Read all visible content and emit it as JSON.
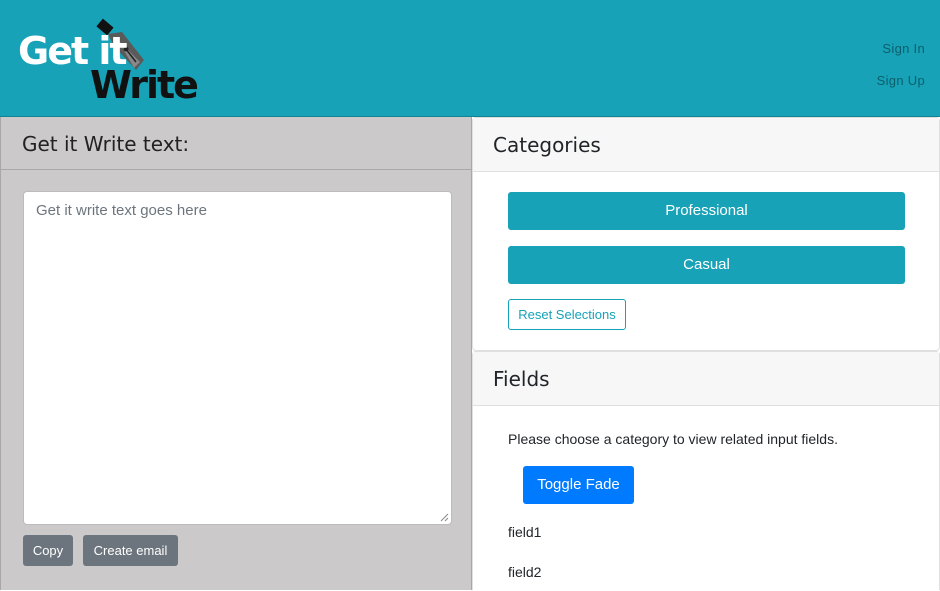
{
  "header": {
    "logo": {
      "line1": "Get it",
      "line2": "Write",
      "icon": "fountain-pen-icon"
    },
    "nav": {
      "sign_in": "Sign In",
      "sign_up": "Sign Up"
    },
    "colors": {
      "bar": "#17a2b8"
    }
  },
  "left": {
    "title": "Get it Write text:",
    "editor_placeholder": "Get it write text goes here",
    "copy_label": "Copy",
    "email_label": "Create email"
  },
  "categories": {
    "title": "Categories",
    "options": [
      "Professional",
      "Casual"
    ],
    "reset_label": "Reset Selections"
  },
  "fields": {
    "title": "Fields",
    "prompt": "Please choose a category to view related input fields.",
    "toggle_label": "Toggle Fade",
    "items": [
      "field1",
      "field2"
    ]
  }
}
